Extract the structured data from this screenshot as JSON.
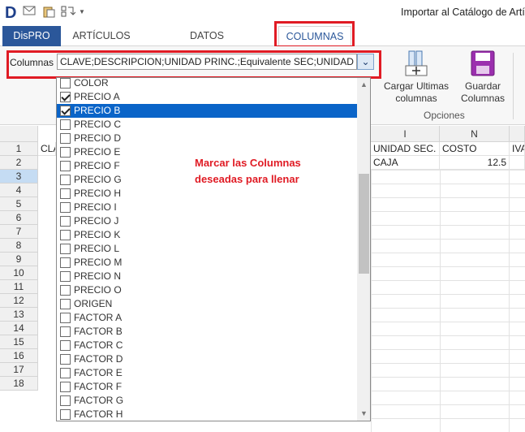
{
  "title_bar": {
    "app_letter": "D",
    "window_title": "Importar al Catálogo de Artíc"
  },
  "tabs": [
    {
      "label": "DisPRO"
    },
    {
      "label": "ARTÍCULOS"
    },
    {
      "label": "DATOS PREDETERMINADOS"
    },
    {
      "label": "COLUMNAS"
    }
  ],
  "ribbon": {
    "columns_label": "Columnas",
    "columns_value": "CLAVE;DESCRIPCION;UNIDAD PRINC.;Equivalente SEC;UNIDAD SEC.;COSTO;IVA",
    "load_button_line1": "Cargar Ultimas",
    "load_button_line2": "columnas",
    "save_button_line1": "Guardar",
    "save_button_line2": "Columnas",
    "group_label": "Opciones"
  },
  "sheet": {
    "column_headers": [
      "I",
      "N"
    ],
    "row_numbers": [
      "1",
      "2",
      "3",
      "4",
      "5",
      "6",
      "7",
      "8",
      "9",
      "10",
      "11",
      "12",
      "13",
      "14",
      "15",
      "16",
      "17",
      "18"
    ],
    "row1_cla": "CLA",
    "row1_unidad_sec": "UNIDAD SEC.",
    "row1_costo": "COSTO",
    "row1_iva": "IVA",
    "row2_unidad_sec": "CAJA",
    "row2_costo": "12.5"
  },
  "dropdown": {
    "items": [
      {
        "label": "COLOR",
        "checked": false
      },
      {
        "label": "PRECIO A",
        "checked": true
      },
      {
        "label": "PRECIO B",
        "checked": true
      },
      {
        "label": "PRECIO C",
        "checked": false
      },
      {
        "label": "PRECIO D",
        "checked": false
      },
      {
        "label": "PRECIO E",
        "checked": false
      },
      {
        "label": "PRECIO F",
        "checked": false
      },
      {
        "label": "PRECIO G",
        "checked": false
      },
      {
        "label": "PRECIO H",
        "checked": false
      },
      {
        "label": "PRECIO I",
        "checked": false
      },
      {
        "label": "PRECIO J",
        "checked": false
      },
      {
        "label": "PRECIO K",
        "checked": false
      },
      {
        "label": "PRECIO L",
        "checked": false
      },
      {
        "label": "PRECIO M",
        "checked": false
      },
      {
        "label": "PRECIO N",
        "checked": false
      },
      {
        "label": "PRECIO O",
        "checked": false
      },
      {
        "label": "ORIGEN",
        "checked": false
      },
      {
        "label": "FACTOR A",
        "checked": false
      },
      {
        "label": "FACTOR B",
        "checked": false
      },
      {
        "label": "FACTOR C",
        "checked": false
      },
      {
        "label": "FACTOR D",
        "checked": false
      },
      {
        "label": "FACTOR E",
        "checked": false
      },
      {
        "label": "FACTOR F",
        "checked": false
      },
      {
        "label": "FACTOR G",
        "checked": false
      },
      {
        "label": "FACTOR H",
        "checked": false
      }
    ],
    "selected_label": "PRECIO B"
  },
  "annotation": {
    "line1": "Marcar las Columnas",
    "line2": "deseadas para llenar"
  },
  "colors": {
    "accent": "#2b579a",
    "highlight_box": "#e01b24",
    "selection": "#0a64c8"
  },
  "icons": [
    "envelope-icon",
    "paste-icon",
    "sync-icon",
    "dropdown-arrow-icon",
    "load-columns-icon",
    "save-icon"
  ]
}
